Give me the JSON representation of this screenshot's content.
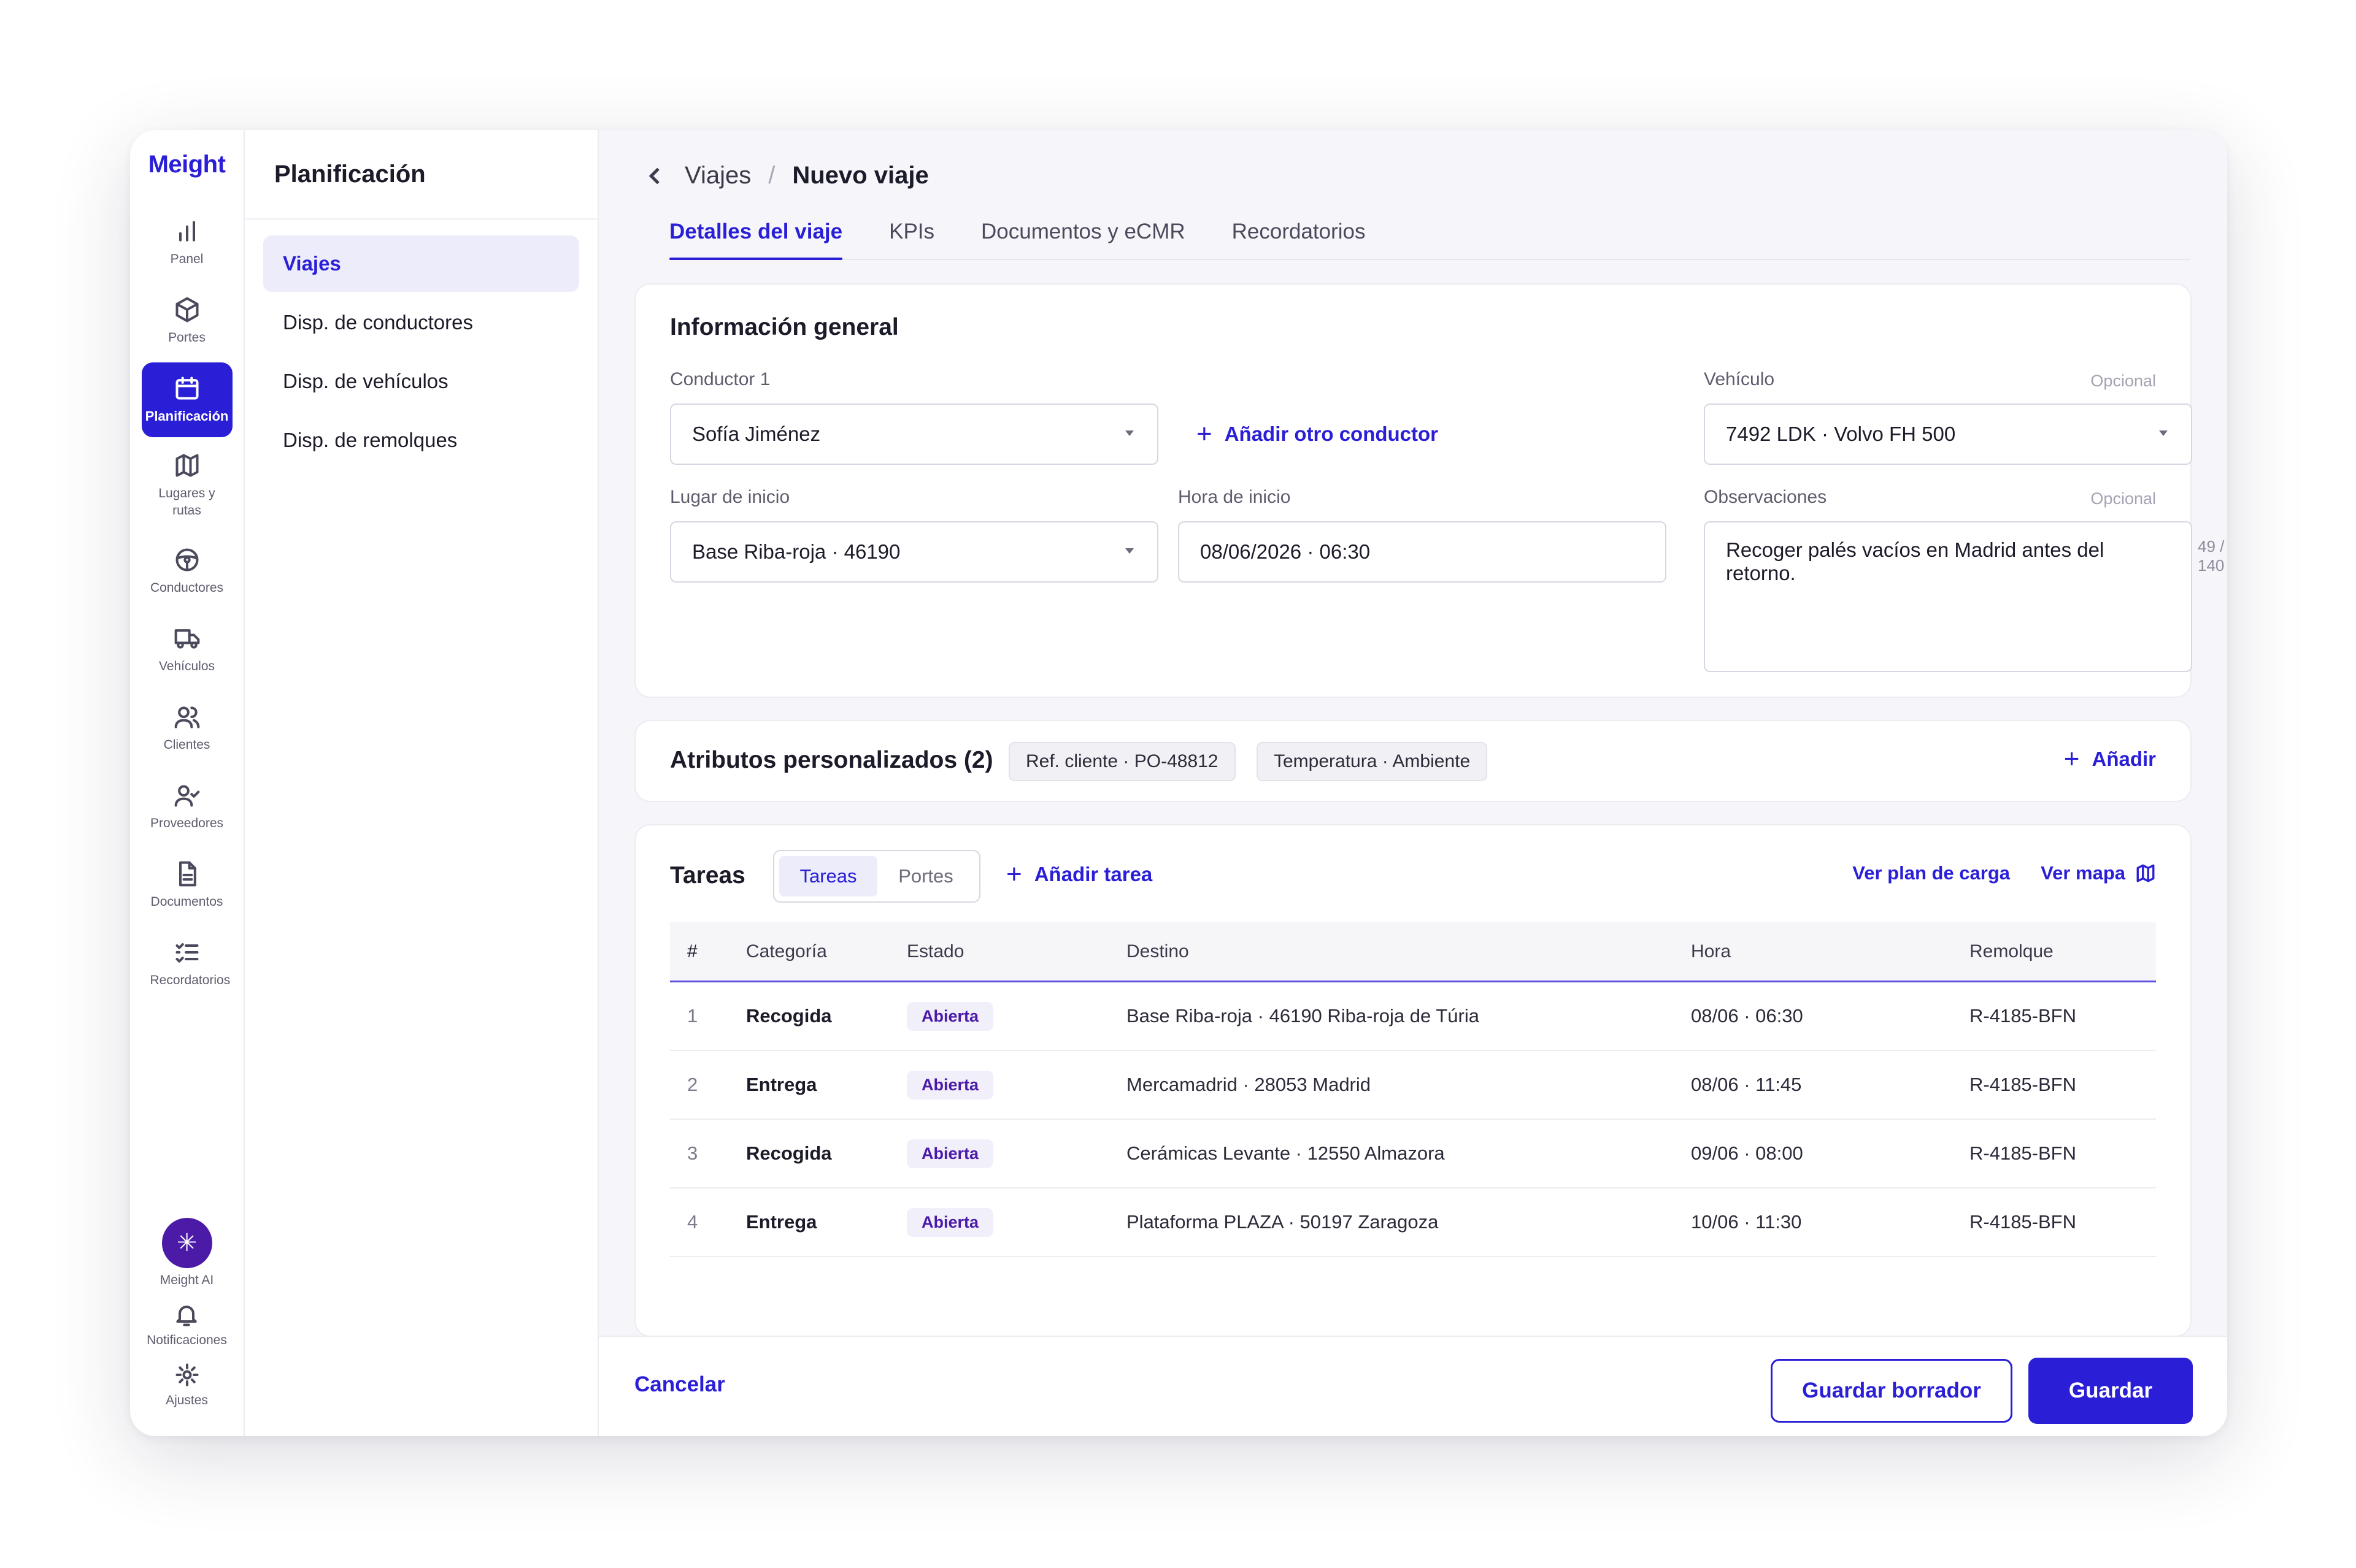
{
  "app": {
    "logo": "Meight"
  },
  "rail": {
    "items": [
      {
        "label": "Panel",
        "icon": "bar-chart-icon"
      },
      {
        "label": "Portes",
        "icon": "box-icon"
      },
      {
        "label": "Planificación",
        "icon": "calendar-icon",
        "active": true
      },
      {
        "label": "Lugares y rutas",
        "icon": "map-icon"
      },
      {
        "label": "Conductores",
        "icon": "steering-wheel-icon"
      },
      {
        "label": "Vehículos",
        "icon": "truck-icon"
      },
      {
        "label": "Clientes",
        "icon": "users-icon"
      },
      {
        "label": "Proveedores",
        "icon": "user-check-icon"
      },
      {
        "label": "Documentos",
        "icon": "document-icon"
      },
      {
        "label": "Recordatorios",
        "icon": "checklist-icon"
      }
    ],
    "bottom": {
      "ai_label": "Meight AI",
      "notifications_label": "Notificaciones",
      "settings_label": "Ajustes"
    }
  },
  "submenu": {
    "title": "Planificación",
    "items": [
      "Viajes",
      "Disp. de conductores",
      "Disp. de vehículos",
      "Disp. de remolques"
    ]
  },
  "breadcrumb": {
    "parent": "Viajes",
    "separator": "/",
    "current": "Nuevo viaje"
  },
  "tabs": [
    "Detalles del viaje",
    "KPIs",
    "Documentos y eCMR",
    "Recordatorios"
  ],
  "general": {
    "title": "Información general",
    "driver_label": "Conductor 1",
    "driver_value": "Sofía Jiménez",
    "add_driver": "Añadir otro conductor",
    "vehicle_label": "Vehículo",
    "vehicle_optional": "Opcional",
    "vehicle_value": "7492 LDK · Volvo FH 500",
    "start_place_label": "Lugar de inicio",
    "start_place_value": "Base Riba-roja · 46190",
    "start_time_label": "Hora de inicio",
    "start_time_value": "08/06/2026 · 06:30",
    "notes_label": "Observaciones",
    "notes_optional": "Opcional",
    "notes_value": "Recoger palés vacíos en Madrid antes del retorno.",
    "notes_counter": "49 / 140"
  },
  "attributes": {
    "title": "Atributos personalizados (2)",
    "chips": [
      "Ref. cliente · PO-48812",
      "Temperatura · Ambiente"
    ],
    "add_label": "Añadir"
  },
  "tasks": {
    "title": "Tareas",
    "segments": [
      "Tareas",
      "Portes"
    ],
    "add_task": "Añadir tarea",
    "load_plan": "Ver plan de carga",
    "view_map": "Ver mapa",
    "columns": [
      "#",
      "Categoría",
      "Estado",
      "Destino",
      "Hora",
      "Remolque"
    ],
    "rows": [
      {
        "num": "1",
        "category": "Recogida",
        "status": "Abierta",
        "destination": "Base Riba-roja · 46190 Riba-roja de Túria",
        "time": "08/06 · 06:30",
        "trailer": "R-4185-BFN"
      },
      {
        "num": "2",
        "category": "Entrega",
        "status": "Abierta",
        "destination": "Mercamadrid · 28053 Madrid",
        "time": "08/06 · 11:45",
        "trailer": "R-4185-BFN"
      },
      {
        "num": "3",
        "category": "Recogida",
        "status": "Abierta",
        "destination": "Cerámicas Levante · 12550 Almazora",
        "time": "09/06 · 08:00",
        "trailer": "R-4185-BFN"
      },
      {
        "num": "4",
        "category": "Entrega",
        "status": "Abierta",
        "destination": "Plataforma PLAZA · 50197 Zaragoza",
        "time": "10/06 · 11:30",
        "trailer": "R-4185-BFN"
      }
    ]
  },
  "footer": {
    "cancel": "Cancelar",
    "save_draft": "Guardar borrador",
    "save": "Guardar"
  },
  "colors": {
    "accent": "#2a1fd6",
    "badge_text": "#4b1ba8",
    "badge_bg": "#f1eff9",
    "ai_button": "#4b1ba8"
  }
}
